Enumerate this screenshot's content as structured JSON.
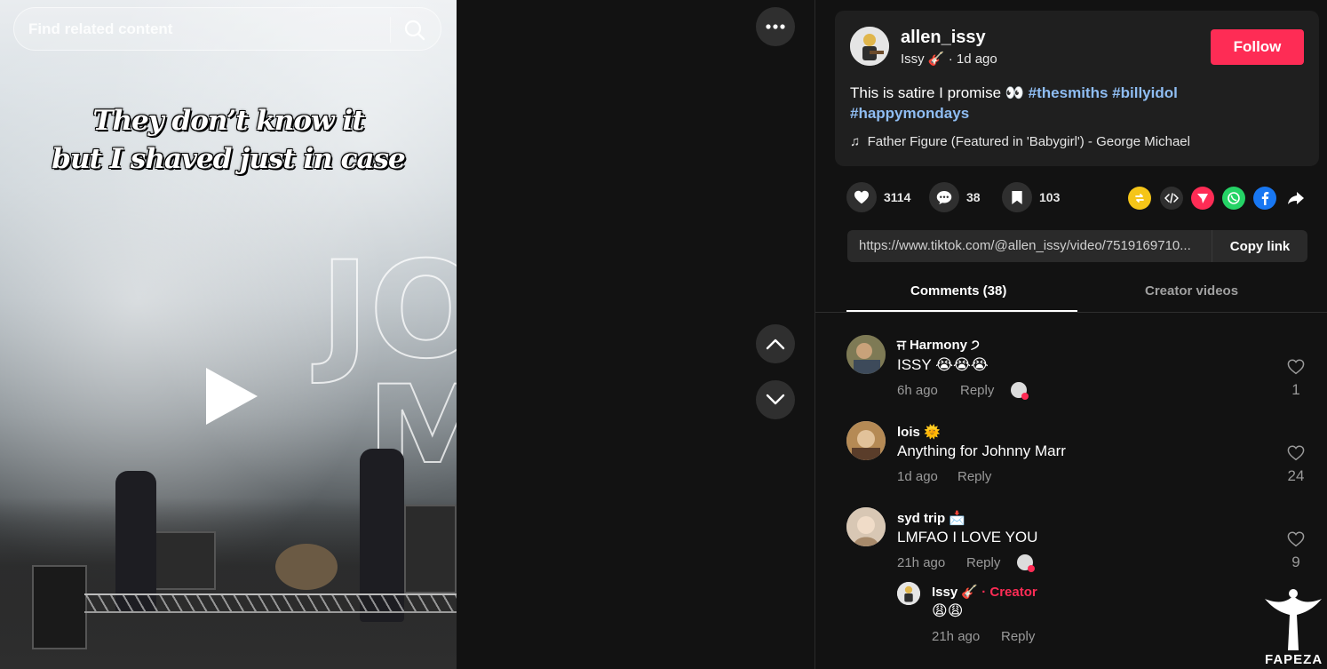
{
  "search": {
    "placeholder": "Find related content"
  },
  "video": {
    "caption_line1": "They don’t know it",
    "caption_line2": "but I shaved just in case",
    "backdrop_letters": "JO\nM"
  },
  "post": {
    "username": "allen_issy",
    "display_name": "Issy 🎸",
    "time": "· 1d ago",
    "follow_label": "Follow",
    "description": "This is satire I promise 👀",
    "hashtags": [
      "#thesmiths",
      "#billyidol",
      "#happymondays"
    ],
    "music_icon": "♫",
    "music": "Father Figure (Featured in 'Babygirl') - George Michael"
  },
  "stats": {
    "likes": "3114",
    "comments": "38",
    "saves": "103"
  },
  "share_icons": [
    "repost-icon",
    "embed-icon",
    "send-icon",
    "whatsapp-icon",
    "facebook-icon",
    "share-arrow-icon"
  ],
  "link": {
    "url": "https://www.tiktok.com/@allen_issy/video/7519169710...",
    "copy_label": "Copy link"
  },
  "tabs": [
    {
      "label": "Comments (38)"
    },
    {
      "label": "Creator videos"
    }
  ],
  "comments": [
    {
      "name": "ਜ Harmony ੭",
      "text": "ISSY 😭😭😭",
      "time": "6h ago",
      "reply": "Reply",
      "likes": "1"
    },
    {
      "name": "lois 🌞",
      "text": "Anything for Johnny Marr",
      "time": "1d ago",
      "reply": "Reply",
      "likes": "24"
    },
    {
      "name": "syd trip 📩",
      "text": "LMFAO I LOVE YOU",
      "time": "21h ago",
      "reply": "Reply",
      "likes": "9",
      "reply_item": {
        "name": "Issy 🎸",
        "creator": "· Creator",
        "text": "😩😩",
        "time": "21h ago",
        "reply": "Reply"
      }
    }
  ],
  "watermark": "FAPEZA",
  "colors": {
    "accent": "#fe2c55",
    "hashtag": "#8fbdf3",
    "panel_bg": "#121212",
    "card_bg": "#1f1f1f"
  }
}
